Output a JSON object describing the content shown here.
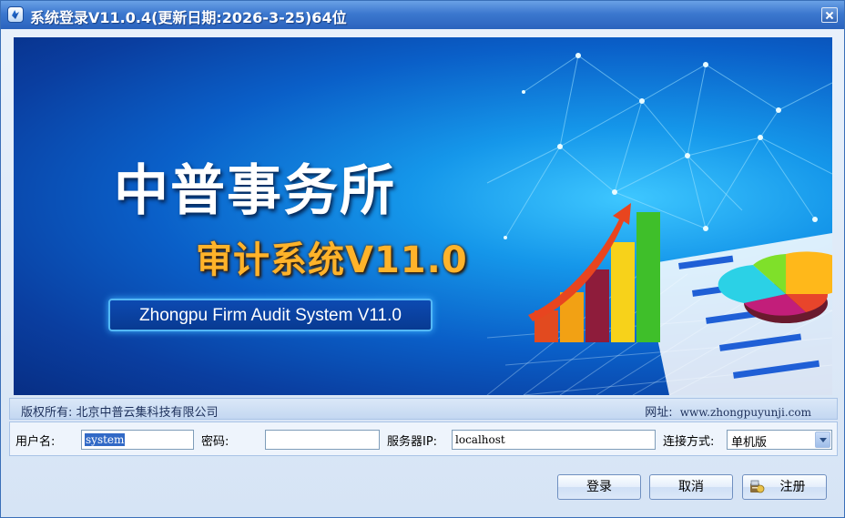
{
  "window": {
    "title": "系统登录V11.0.4(更新日期:2026-3-25)64位"
  },
  "banner": {
    "brand_line1": "中普事务所",
    "brand_line2": "审计系统V11.0",
    "brand_english": "Zhongpu Firm Audit System V11.0"
  },
  "info": {
    "copyright": "版权所有: 北京中普云集科技有限公司",
    "website_label": "网址:",
    "website_url": "www.zhongpuyunji.com"
  },
  "form": {
    "username_label": "用户名:",
    "username_value": "system",
    "password_label": "密码:",
    "password_value": "",
    "server_label": "服务器IP:",
    "server_value": "localhost",
    "connection_label": "连接方式:",
    "connection_value": "单机版"
  },
  "buttons": {
    "login": "登录",
    "cancel": "取消",
    "register": "注册"
  }
}
